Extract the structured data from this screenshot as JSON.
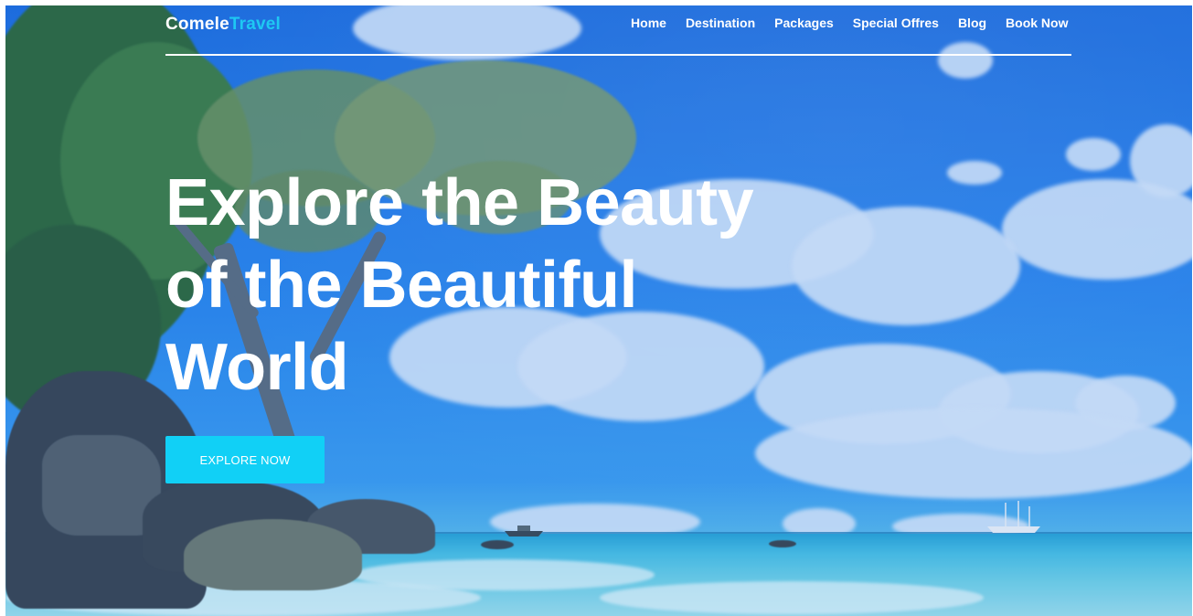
{
  "brand": {
    "name_part1": "Comele",
    "name_part2": "Travel",
    "accent_color": "#1ec8f3"
  },
  "nav": {
    "items": [
      {
        "label": "Home"
      },
      {
        "label": "Destination"
      },
      {
        "label": "Packages"
      },
      {
        "label": "Special Offres"
      },
      {
        "label": "Blog"
      },
      {
        "label": "Book Now"
      }
    ]
  },
  "hero": {
    "headline_lines": [
      "Explore the Beauty",
      "of the Beautiful",
      "World"
    ],
    "cta_label": "EXPLORE NOW",
    "cta_color": "#11d0f6",
    "background": "tropical-beach-photo"
  }
}
